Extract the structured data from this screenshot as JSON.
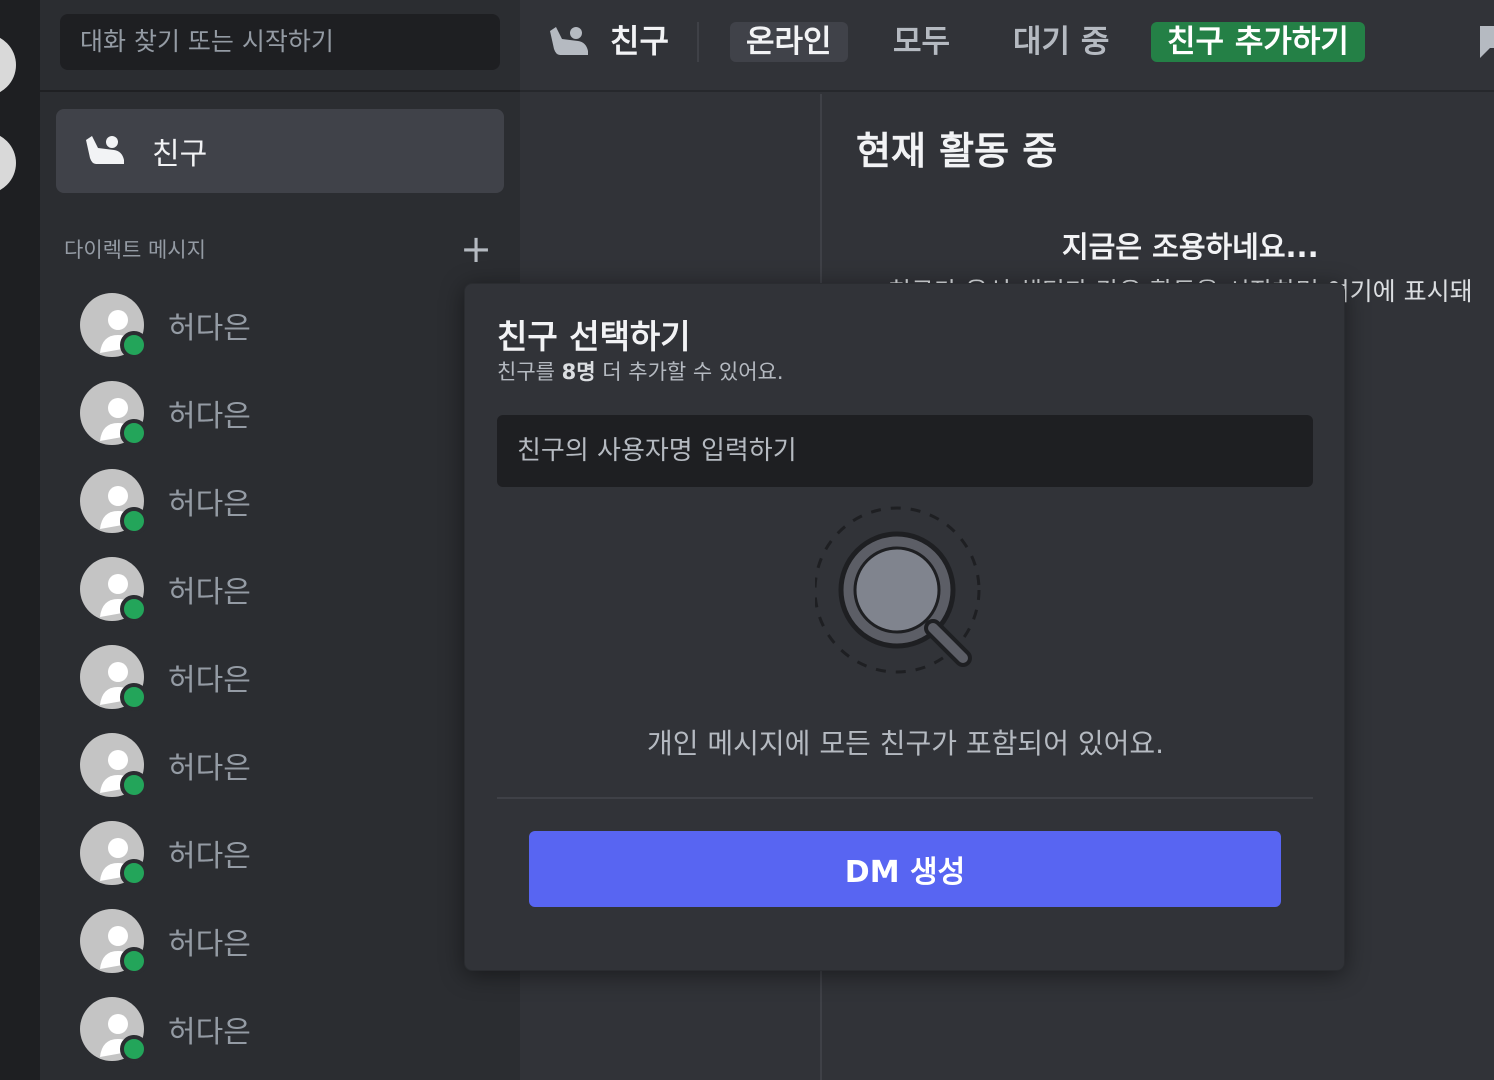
{
  "sidebar": {
    "search_placeholder": "대화 찾기 또는 시작하기",
    "friends_label": "친구",
    "dm_header": "다이렉트 메시지",
    "dm_add": "+",
    "dms": [
      {
        "name": "허다은"
      },
      {
        "name": "허다은"
      },
      {
        "name": "허다은"
      },
      {
        "name": "허다은"
      },
      {
        "name": "허다은"
      },
      {
        "name": "허다은"
      },
      {
        "name": "허다은"
      },
      {
        "name": "허다은"
      },
      {
        "name": "허다은"
      }
    ]
  },
  "topbar": {
    "title": "친구",
    "tabs": {
      "online": "온라인",
      "all": "모두",
      "pending": "대기 중",
      "add_friend": "친구 추가하기"
    }
  },
  "active_now": {
    "title": "현재 활동 중",
    "quiet": "지금은 조용하네요...",
    "desc": "친구가 음성 채팅과 같은 활동을 시작하면 여기에 표시돼"
  },
  "popup": {
    "title": "친구 선택하기",
    "sub_prefix": "친구를 ",
    "sub_count": "8명",
    "sub_suffix": " 더 추가할 수 있어요.",
    "input_placeholder": "친구의 사용자명 입력하기",
    "empty_text": "개인 메시지에 모든 친구가 포함되어 있어요.",
    "create_button": "DM 생성"
  },
  "colors": {
    "accent": "#5865f2",
    "online_status": "#23a55a",
    "add_friend_bg": "#248046"
  }
}
